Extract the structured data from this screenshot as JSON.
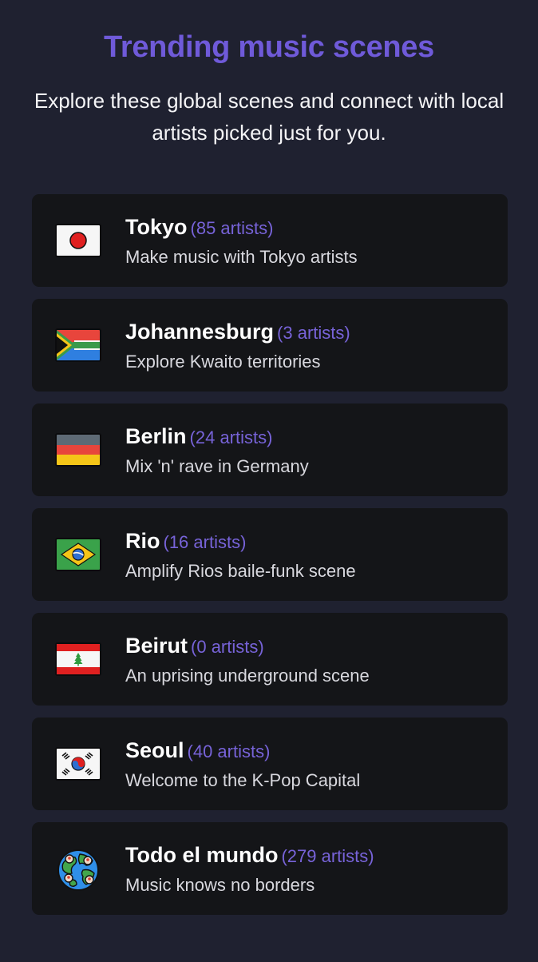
{
  "header": {
    "title": "Trending music scenes",
    "subtitle": "Explore these global scenes and connect with local artists picked just for you."
  },
  "scenes": [
    {
      "city": "Tokyo",
      "count": "(85 artists)",
      "description": "Make music with Tokyo artists",
      "icon": "japan-flag-icon"
    },
    {
      "city": "Johannesburg",
      "count": "(3 artists)",
      "description": "Explore Kwaito territories",
      "icon": "south-africa-flag-icon"
    },
    {
      "city": "Berlin",
      "count": "(24 artists)",
      "description": "Mix 'n' rave in Germany",
      "icon": "germany-flag-icon"
    },
    {
      "city": "Rio",
      "count": "(16 artists)",
      "description": "Amplify Rios baile-funk scene",
      "icon": "brazil-flag-icon"
    },
    {
      "city": "Beirut",
      "count": "(0 artists)",
      "description": "An uprising underground scene",
      "icon": "lebanon-flag-icon"
    },
    {
      "city": "Seoul",
      "count": "(40 artists)",
      "description": "Welcome to the K-Pop Capital",
      "icon": "south-korea-flag-icon"
    },
    {
      "city": "Todo el mundo",
      "count": "(279 artists)",
      "description": "Music knows no borders",
      "icon": "globe-icon"
    }
  ],
  "colors": {
    "background": "#1f2130",
    "card": "#141518",
    "accent": "#6f5ad9"
  }
}
